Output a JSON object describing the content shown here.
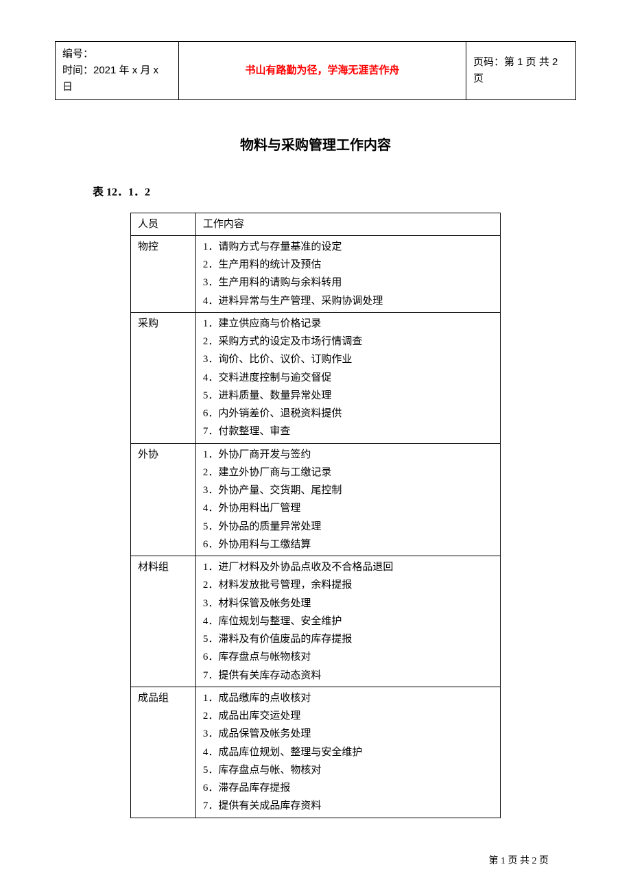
{
  "header": {
    "doc_number_label": "编号：",
    "time_label": "时间：2021 年 x 月 x 日",
    "motto": "书山有路勤为径，学海无涯苦作舟",
    "page_label": "页码：第 1 页 共 2 页"
  },
  "title": "物料与采购管理工作内容",
  "table_label": "表 12．1．2",
  "columns": {
    "role": "人员",
    "content": "工作内容"
  },
  "rows": [
    {
      "role": "物控",
      "items": [
        "1．请购方式与存量基准的设定",
        "2．生产用料的统计及预估",
        "3．生产用料的请购与余料转用",
        "4．进料异常与生产管理、采购协调处理"
      ]
    },
    {
      "role": "采购",
      "items": [
        "1．建立供应商与价格记录",
        "2．采购方式的设定及市场行情调查",
        "3．询价、比价、议价、订购作业",
        "4．交料进度控制与逾交督促",
        "5．进料质量、数量异常处理",
        "6．内外销差价、退税资料提供",
        "7．付款整理、审查"
      ]
    },
    {
      "role": "外协",
      "items": [
        "1．外协厂商开发与签约",
        "2．建立外协厂商与工缴记录",
        "3．外协产量、交货期、尾控制",
        "4．外协用料出厂管理",
        "5．外协品的质量异常处理",
        "6．外协用料与工缴结算"
      ]
    },
    {
      "role": "材料组",
      "items": [
        "1．进厂材料及外协品点收及不合格品退回",
        "2．材料发放批号管理，余料提报",
        "3．材料保管及帐务处理",
        "4．库位规划与整理、安全维护",
        "5．滞料及有价值废品的库存提报",
        "6．库存盘点与帐物核对",
        "7．提供有关库存动态资料"
      ]
    },
    {
      "role": "成品组",
      "items": [
        "1．成品缴库的点收核对",
        "2．成品出库交运处理",
        "3．成品保管及帐务处理",
        "4．成品库位规划、整理与安全维护",
        "5．库存盘点与帐、物核对",
        "6．滞存品库存提报",
        "7．提供有关成品库存资料"
      ]
    }
  ],
  "footer": "第 1 页 共 2 页"
}
